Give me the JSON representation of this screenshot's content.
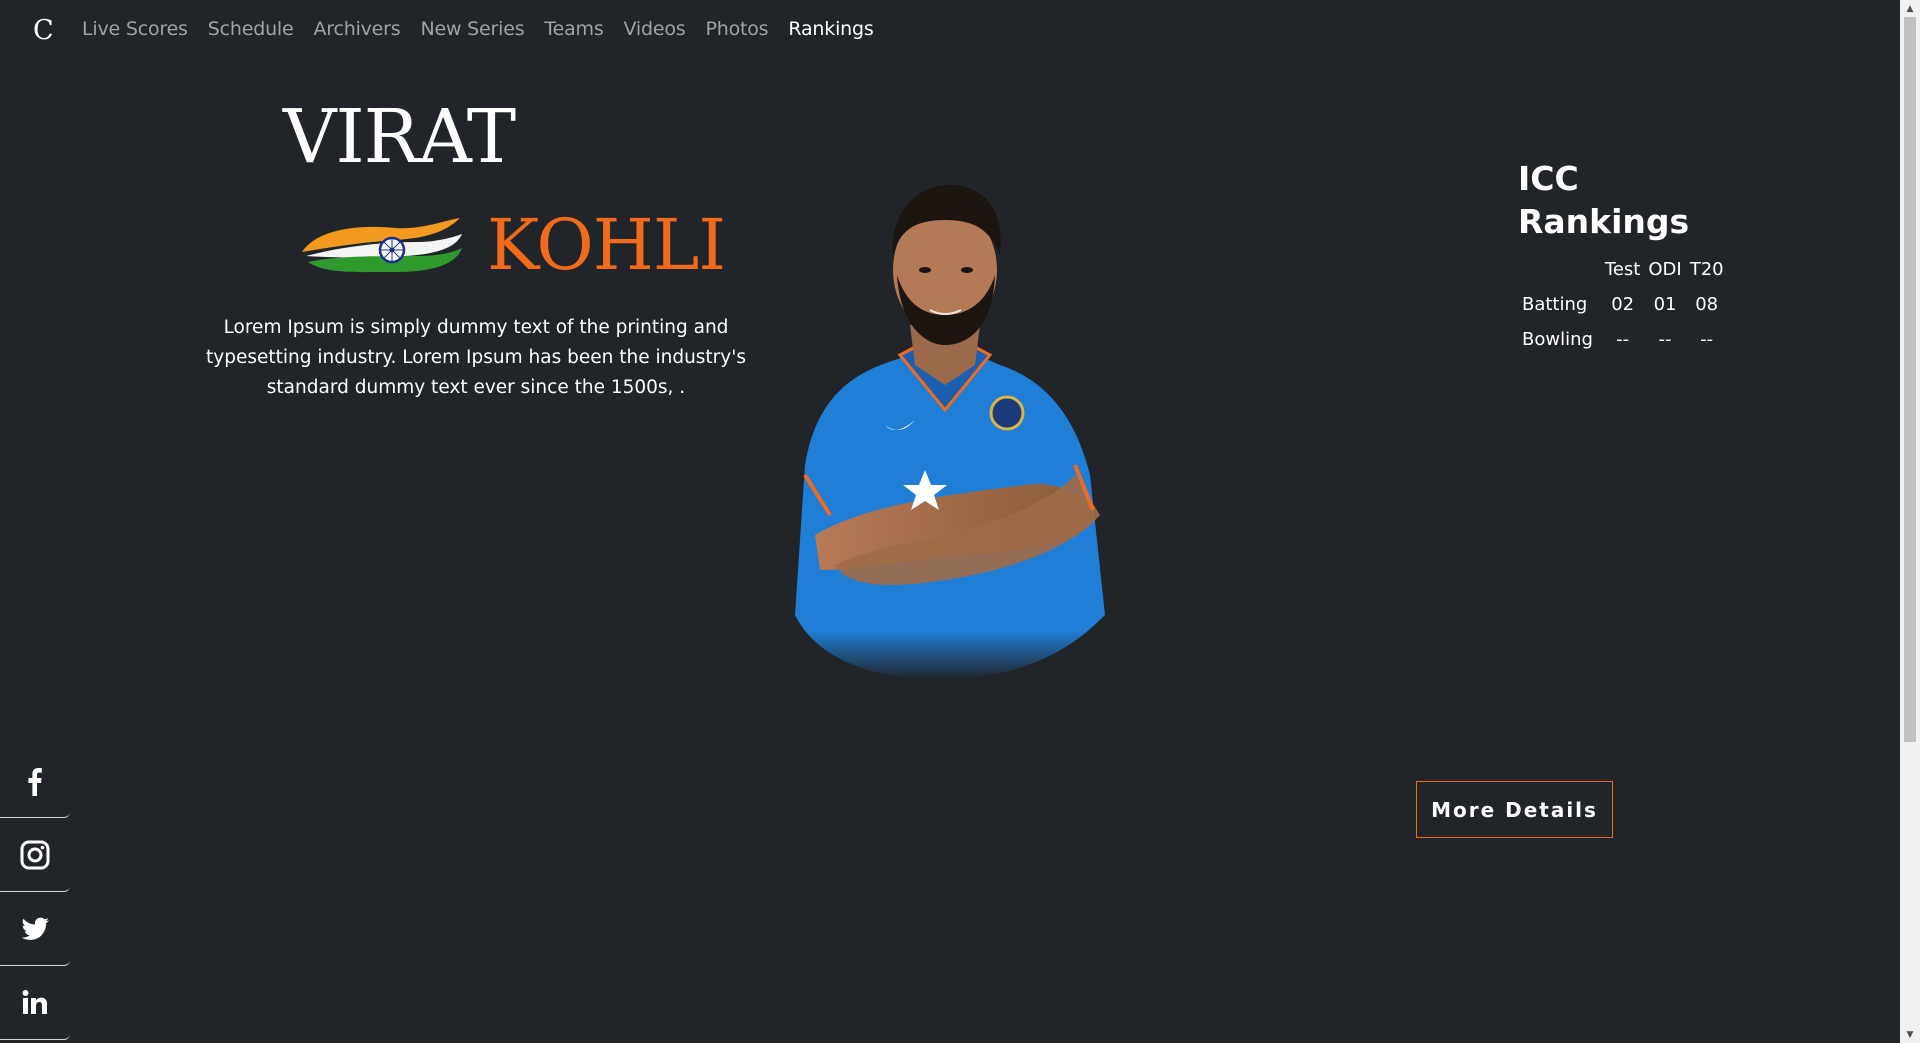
{
  "nav": {
    "brand": "C",
    "links": [
      {
        "label": "Live Scores",
        "active": false
      },
      {
        "label": "Schedule",
        "active": false
      },
      {
        "label": "Archivers",
        "active": false
      },
      {
        "label": "New Series",
        "active": false
      },
      {
        "label": "Teams",
        "active": false
      },
      {
        "label": "Videos",
        "active": false
      },
      {
        "label": "Photos",
        "active": false
      },
      {
        "label": "Rankings",
        "active": true
      }
    ]
  },
  "hero": {
    "first_name": "VIRAT",
    "last_name": "KOHLI",
    "description": "Lorem Ipsum is simply dummy text of the printing and typesetting industry. Lorem Ipsum has been the industry's standard dummy text ever since the 1500s, ."
  },
  "rankings": {
    "title_line1": "ICC",
    "title_line2": "Rankings",
    "columns": [
      "Test",
      "ODI",
      "T20"
    ],
    "rows": [
      {
        "label": "Batting",
        "values": [
          "02",
          "01",
          "08"
        ]
      },
      {
        "label": "Bowling",
        "values": [
          "--",
          "--",
          "--"
        ]
      }
    ],
    "button_label": "More Details"
  },
  "social": [
    "facebook-icon",
    "instagram-icon",
    "twitter-icon",
    "linkedin-icon"
  ],
  "colors": {
    "background": "#212429",
    "accent": "#f26b1d",
    "nav_inactive": "#9ea3a8",
    "jersey": "#1f7fd6"
  }
}
